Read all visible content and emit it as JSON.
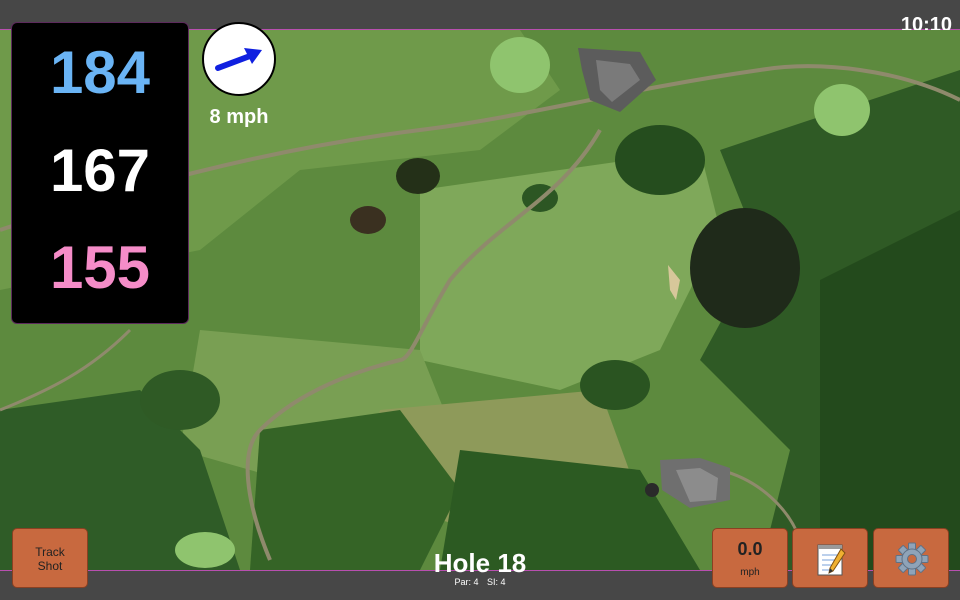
{
  "status_bar": {
    "time": "10:10"
  },
  "yardage": {
    "back": "184",
    "middle": "167",
    "front": "155",
    "colors": {
      "back": "#6ab4f5",
      "middle": "#ffffff",
      "front": "#f58cc8"
    }
  },
  "wind": {
    "speed": "8 mph",
    "arrow_color": "#1020e0"
  },
  "buttons": {
    "track_shot_line1": "Track",
    "track_shot_line2": "Shot",
    "speed_value": "0.0",
    "speed_unit": "mph",
    "notes_icon": "notepad-pencil-icon",
    "settings_icon": "gear-icon",
    "accent": "#c8693f"
  },
  "hole": {
    "title": "Hole 18",
    "par": "Par: 4",
    "stroke_index": "SI: 4"
  }
}
